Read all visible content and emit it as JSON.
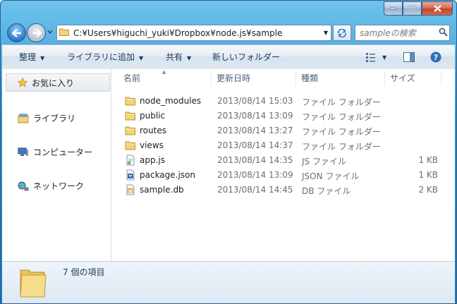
{
  "window": {
    "address_path": "C:¥Users¥higuchi_yuki¥Dropbox¥node.js¥sample",
    "search_placeholder": "sampleの検索"
  },
  "toolbar": {
    "organize": "整理",
    "add_to_library": "ライブラリに追加",
    "share": "共有",
    "new_folder": "新しいフォルダー"
  },
  "navigation": {
    "favorites": "お気に入り",
    "libraries": "ライブラリ",
    "computer": "コンピューター",
    "network": "ネットワーク"
  },
  "columns": {
    "name": "名前",
    "date": "更新日時",
    "type": "種類",
    "size": "サイズ"
  },
  "files": [
    {
      "name": "node_modules",
      "date": "2013/08/14 15:03",
      "type": "ファイル フォルダー",
      "size": "",
      "icon": "folder-icon"
    },
    {
      "name": "public",
      "date": "2013/08/14 13:09",
      "type": "ファイル フォルダー",
      "size": "",
      "icon": "folder-icon"
    },
    {
      "name": "routes",
      "date": "2013/08/14 13:27",
      "type": "ファイル フォルダー",
      "size": "",
      "icon": "folder-icon"
    },
    {
      "name": "views",
      "date": "2013/08/14 14:37",
      "type": "ファイル フォルダー",
      "size": "",
      "icon": "folder-icon"
    },
    {
      "name": "app.js",
      "date": "2013/08/14 14:35",
      "type": "JS ファイル",
      "size": "1 KB",
      "icon": "js-file-icon"
    },
    {
      "name": "package.json",
      "date": "2013/08/14 13:09",
      "type": "JSON ファイル",
      "size": "1 KB",
      "icon": "json-file-icon"
    },
    {
      "name": "sample.db",
      "date": "2013/08/14 14:45",
      "type": "DB ファイル",
      "size": "2 KB",
      "icon": "db-file-icon"
    }
  ],
  "details": {
    "item_count": "7 個の項目"
  },
  "colors": {
    "frame": "#2a8fd0",
    "folder": "#e8c35a"
  }
}
